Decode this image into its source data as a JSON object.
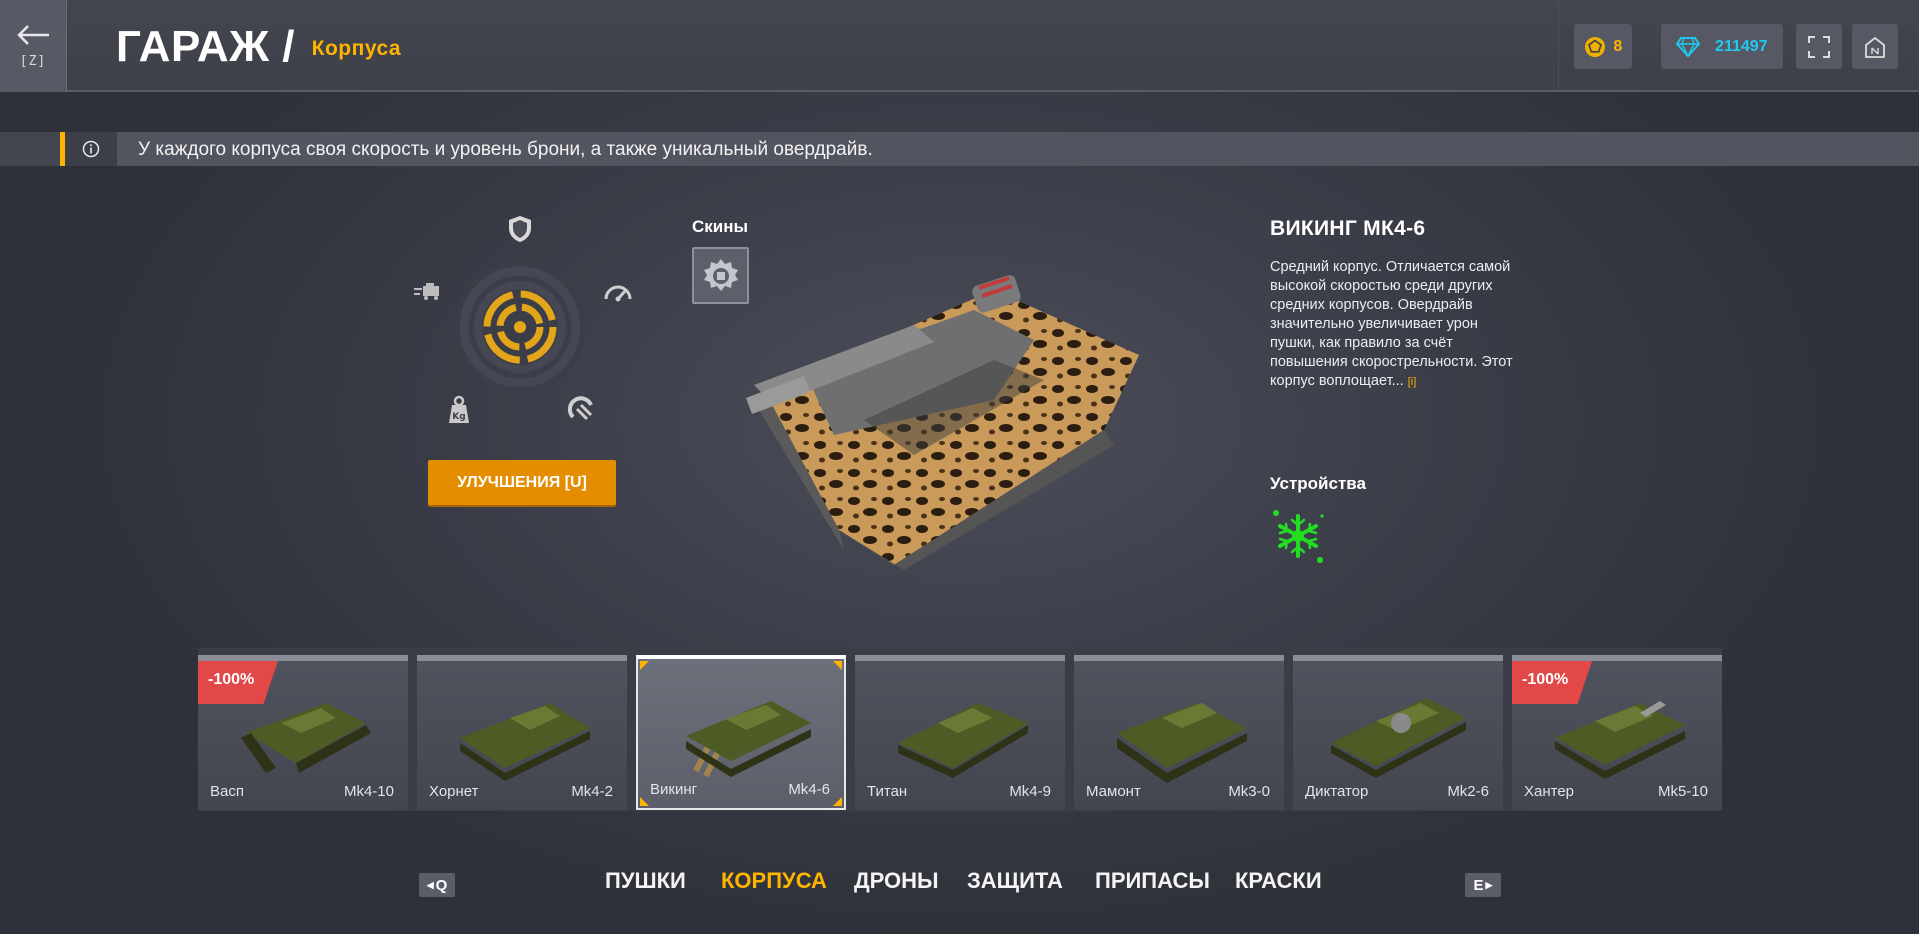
{
  "header": {
    "back_key": "[Z]",
    "title": "ГАРАЖ /",
    "subtitle": "Корпуса",
    "crystals": "8",
    "diamonds": "211497"
  },
  "tip": {
    "text": "У каждого корпуса своя скорость и уровень брони, а также уникальный овердрайв."
  },
  "stats": {
    "upgrade_label": "УЛУЧШЕНИЯ [U]",
    "icons": [
      "shield-icon",
      "speedometer-icon",
      "turning-icon",
      "weight-icon",
      "traction-icon"
    ]
  },
  "skins": {
    "label": "Скины"
  },
  "hull": {
    "name": "ВИКИНГ МК4-6",
    "description": "Средний корпус. Отличается самой высокой скоростью среди других средних корпусов. Овердрайв значительно увеличивает урон пушки, как правило за счёт повышения скорострельности. Этот корпус воплощает...",
    "more": "[i]",
    "devices_label": "Устройства"
  },
  "cards": [
    {
      "name": "Васп",
      "mk": "Мk4-10",
      "discount": "-100%"
    },
    {
      "name": "Хорнет",
      "mk": "Мk4-2",
      "discount": ""
    },
    {
      "name": "Викинг",
      "mk": "Мk4-6",
      "discount": ""
    },
    {
      "name": "Титан",
      "mk": "Мk4-9",
      "discount": ""
    },
    {
      "name": "Мамонт",
      "mk": "Мk3-0",
      "discount": ""
    },
    {
      "name": "Диктатор",
      "mk": "Мk2-6",
      "discount": ""
    },
    {
      "name": "Хантер",
      "mk": "Мk5-10",
      "discount": "-100%"
    }
  ],
  "nav": {
    "prev_key": "Q",
    "next_key": "E",
    "items": [
      "ПУШКИ",
      "КОРПУСА",
      "ДРОНЫ",
      "ЗАЩИТА",
      "ПРИПАСЫ",
      "КРАСКИ"
    ],
    "active": "КОРПУСА"
  },
  "colors": {
    "accent": "#ffb400",
    "upgrade": "#e58d00",
    "diamond": "#22c8f0",
    "discount": "#e24848",
    "device": "#22dd22"
  }
}
